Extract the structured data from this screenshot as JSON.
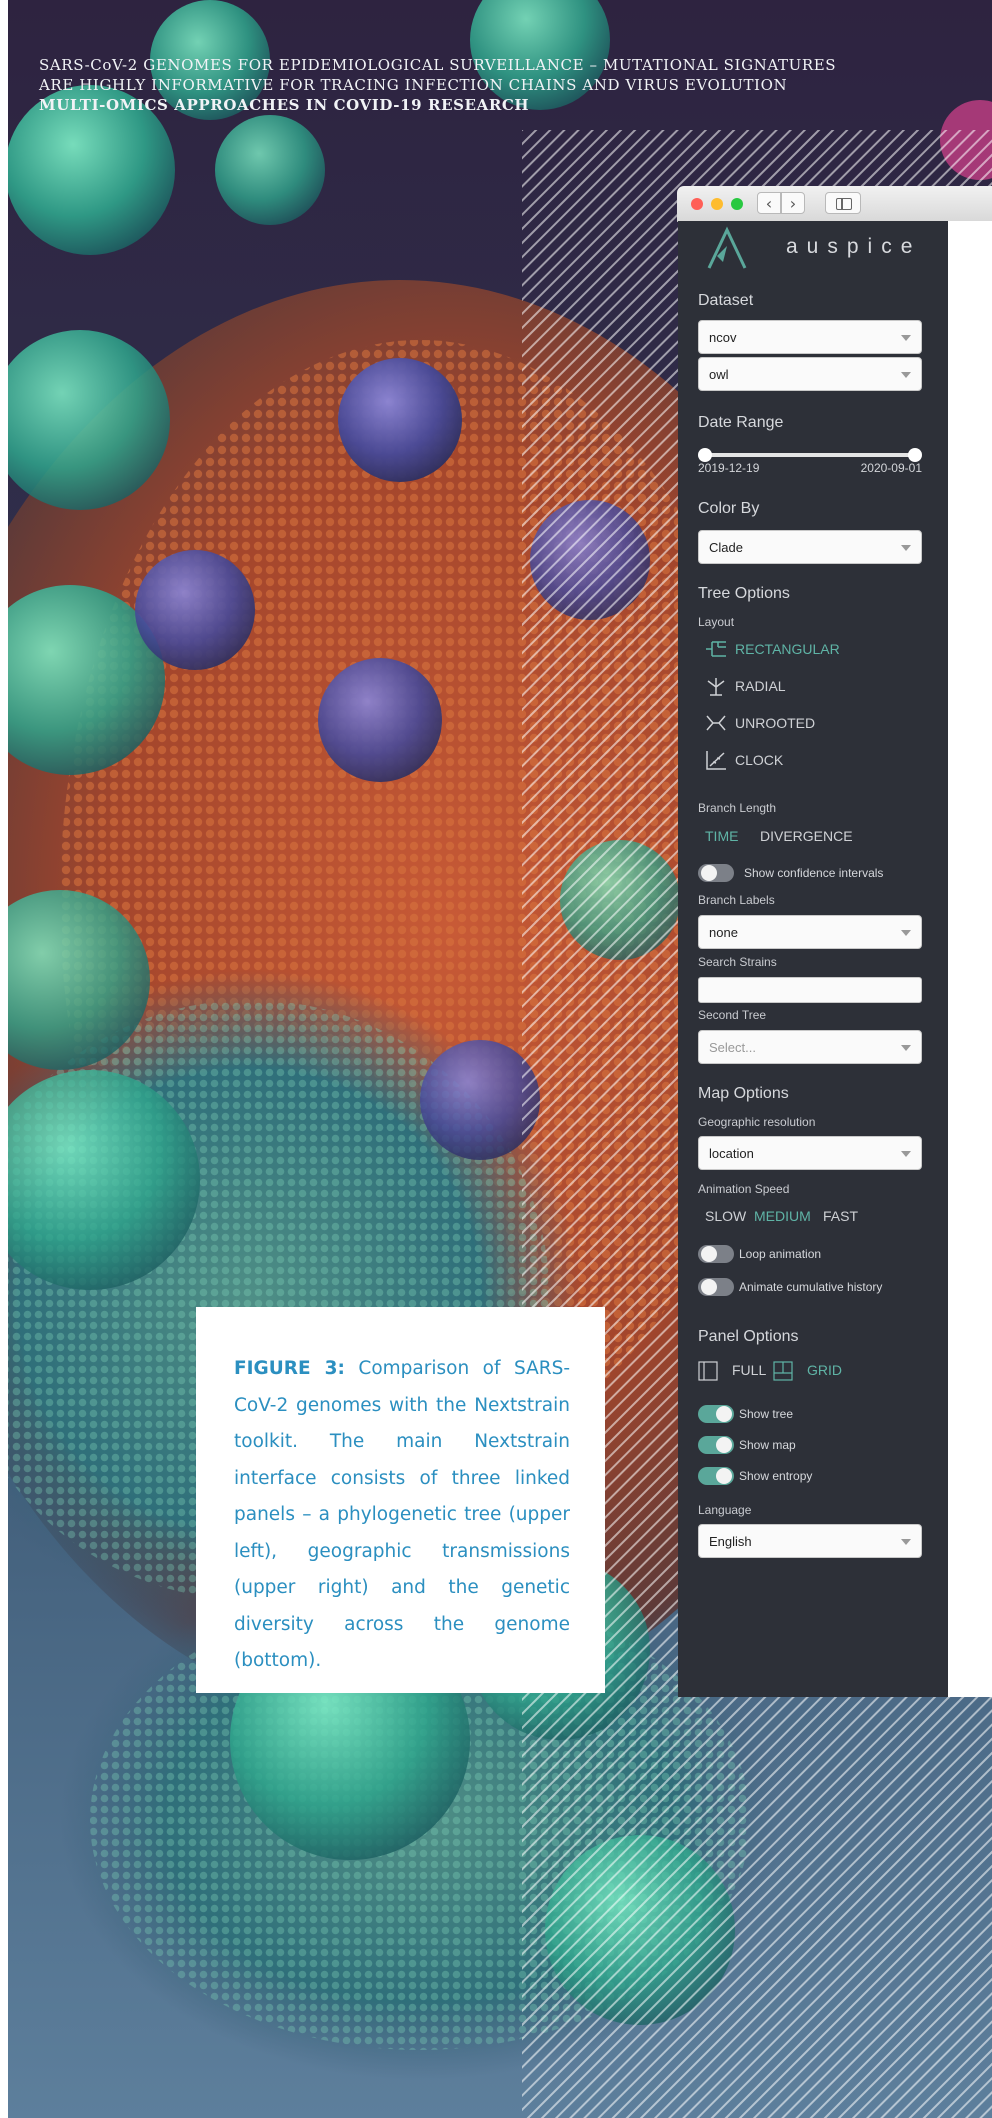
{
  "header": {
    "line1": "SARS-CoV-2 GENOMES FOR EPIDEMIOLOGICAL SURVEILLANCE – MUTATIONAL SIGNATURES",
    "line2": "ARE HIGHLY INFORMATIVE FOR TRACING INFECTION CHAINS AND VIRUS EVOLUTION",
    "line3": "MULTI-OMICS APPROACHES IN COVID-19 RESEARCH"
  },
  "browser": {
    "back_glyph": "‹",
    "forward_glyph": "›"
  },
  "auspice": {
    "brand": "auspice",
    "dataset": {
      "title": "Dataset",
      "select1": "ncov",
      "select2": "owl"
    },
    "date_range": {
      "title": "Date Range",
      "start": "2019-12-19",
      "end": "2020-09-01"
    },
    "color_by": {
      "title": "Color By",
      "value": "Clade"
    },
    "tree_options": {
      "title": "Tree Options",
      "layout_label": "Layout",
      "layouts": [
        "RECTANGULAR",
        "RADIAL",
        "UNROOTED",
        "CLOCK"
      ],
      "selected_layout": "RECTANGULAR",
      "branch_length_label": "Branch Length",
      "branch_time": "TIME",
      "branch_divergence": "DIVERGENCE",
      "confidence_toggle": "Show confidence intervals",
      "branch_labels_label": "Branch Labels",
      "branch_labels_value": "none",
      "search_strains_label": "Search Strains",
      "search_strains_value": "",
      "second_tree_label": "Second Tree",
      "second_tree_placeholder": "Select..."
    },
    "map_options": {
      "title": "Map Options",
      "geo_label": "Geographic resolution",
      "geo_value": "location",
      "speed_label": "Animation Speed",
      "speed_slow": "SLOW",
      "speed_medium": "MEDIUM",
      "speed_fast": "FAST",
      "loop_toggle": "Loop animation",
      "cumulative_toggle": "Animate cumulative history"
    },
    "panel_options": {
      "title": "Panel Options",
      "full": "FULL",
      "grid": "GRID",
      "show_tree": "Show tree",
      "show_map": "Show map",
      "show_entropy": "Show entropy",
      "language_label": "Language",
      "language_value": "English"
    },
    "accent_color": "#5fb4a6"
  },
  "caption": {
    "figure_label": "FIGURE 3:",
    "text": "Comparison of SARS-CoV-2 genomes with the Nextstrain toolkit. The main Nextstrain interface consists of three linked panels – a phylogenetic tree (upper left), geographic transmissions (upper right) and the genetic diversity across the genome (bottom).",
    "color": "#2b8fc0"
  }
}
